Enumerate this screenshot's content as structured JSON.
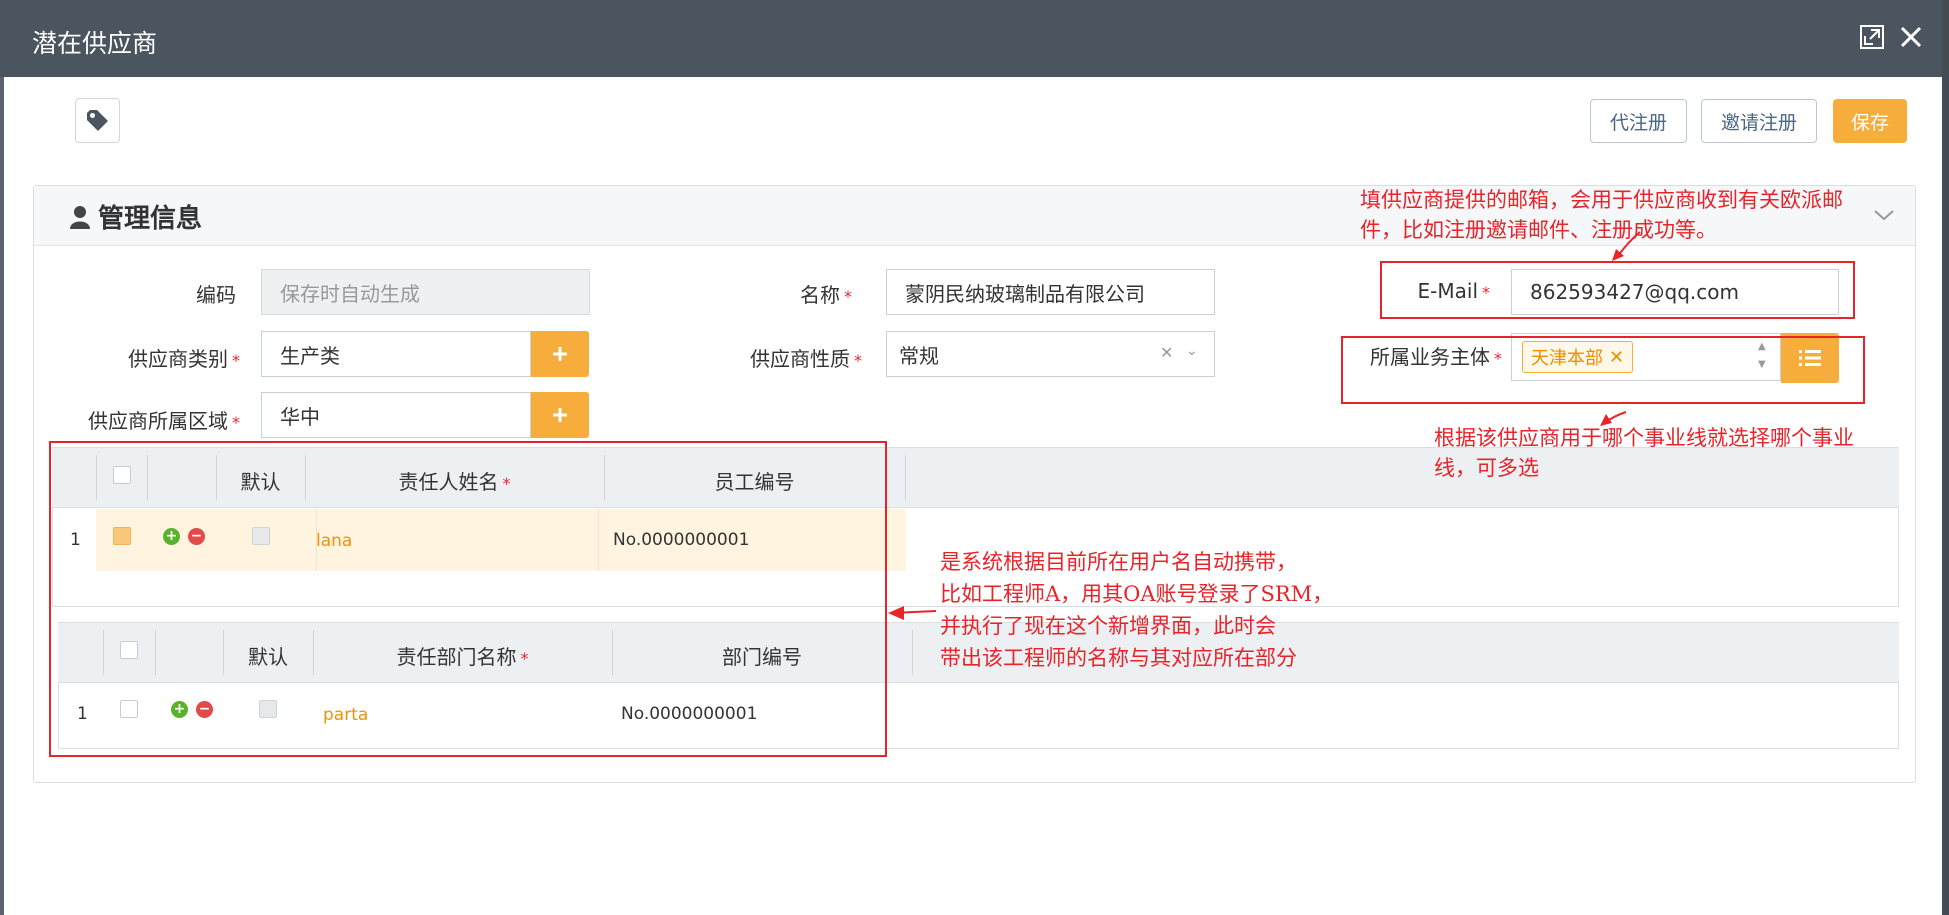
{
  "dialog": {
    "title": "潜在供应商"
  },
  "toolbar": {
    "register_for": "代注册",
    "invite_register": "邀请注册",
    "save": "保存"
  },
  "panel": {
    "title": "管理信息"
  },
  "form": {
    "code_label": "编码",
    "code_placeholder": "保存时自动生成",
    "name_label": "名称",
    "name_value": "蒙阴民纳玻璃制品有限公司",
    "email_label": "E-Mail",
    "email_value": "862593427@qq.com",
    "category_label": "供应商类别",
    "category_value": "生产类",
    "nature_label": "供应商性质",
    "nature_value": "常规",
    "biz_label": "所属业务主体",
    "biz_chip": "天津本部",
    "region_label": "供应商所属区域",
    "region_value": "华中",
    "required_mark": "*"
  },
  "grid1": {
    "headers": [
      "默认",
      "责任人姓名",
      "员工编号"
    ],
    "rows": [
      {
        "index": "1",
        "name": "lana",
        "no": "No.0000000001"
      }
    ]
  },
  "grid2": {
    "headers": [
      "默认",
      "责任部门名称",
      "部门编号"
    ],
    "rows": [
      {
        "index": "1",
        "name": "parta",
        "no": "No.0000000001"
      }
    ]
  },
  "annotations": {
    "email_note_1": "填供应商提供的邮箱，会用于供应商收到有关欧派邮",
    "email_note_2": "件，比如注册邀请邮件、注册成功等。",
    "biz_note_1": "根据该供应商用于哪个事业线就选择哪个事业",
    "biz_note_2": "线，可多选",
    "grid_note_1": "是系统根据目前所在用户名自动携带，",
    "grid_note_2": "比如工程师A，用其OA账号登录了SRM，",
    "grid_note_3": "并执行了现在这个新增界面，此时会",
    "grid_note_4": "带出该工程师的名称与其对应所在部分"
  },
  "colors": {
    "header_bg": "#4b5560",
    "accent": "#f6ad3c",
    "annotation": "#e8242a"
  }
}
